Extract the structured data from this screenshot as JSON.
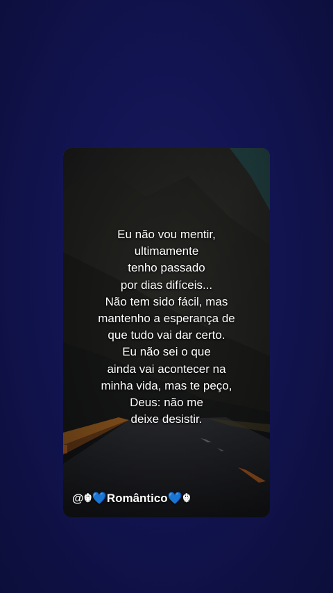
{
  "quote_lines": [
    "Eu não vou mentir,",
    "ultimamente",
    " tenho passado",
    "por dias difíceis...",
    "Não tem sido fácil, mas",
    " mantenho a esperança de",
    " que tudo vai dar certo.",
    "Eu não sei o que",
    "ainda vai acontecer na",
    "minha vida, mas te peço,",
    "Deus: não me",
    " deixe desistir."
  ],
  "handle": "@☬💙Romântico💙☬",
  "colors": {
    "background": "#121452",
    "road": "#2a2c30",
    "road_line": "#e0782a",
    "mountain": "#2b2d2a",
    "sky": "#2f5f63"
  }
}
